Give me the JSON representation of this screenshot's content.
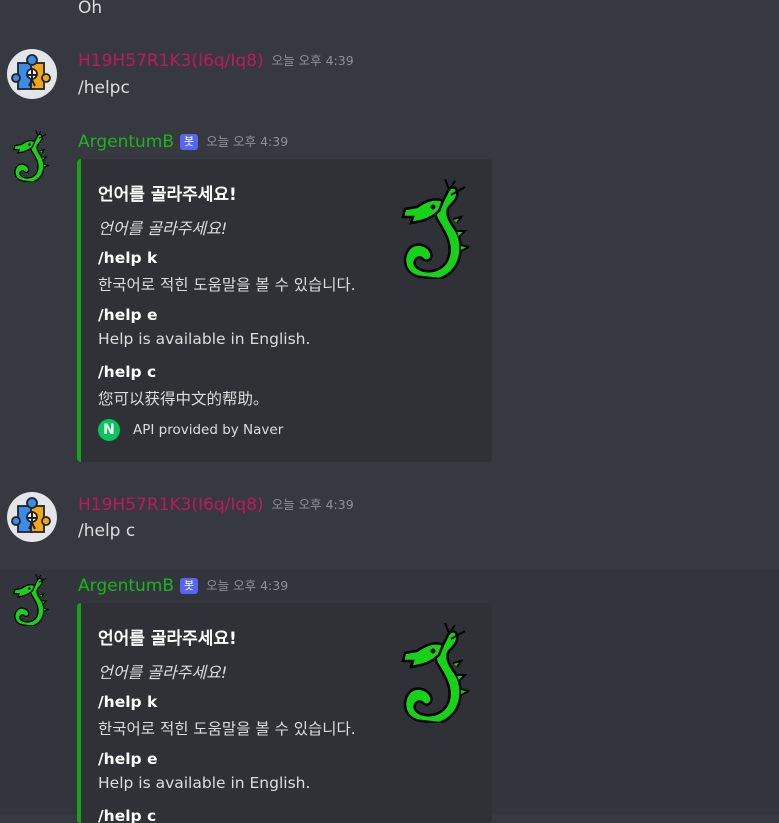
{
  "top_message": {
    "text": "Oh"
  },
  "messages": [
    {
      "author": "H19H57R1K3(I6q/Iq8)",
      "timestamp": "오늘 오후 4:39",
      "text": "/helpc"
    },
    {
      "author": "ArgentumB",
      "badge": "봇",
      "timestamp": "오늘 오후 4:39",
      "embed": {
        "title": "언어를 골라주세요!",
        "description": "언어를 골라주세요!",
        "fields": [
          {
            "name": "/help k",
            "value": "한국어로 적힌 도움말을 볼 수 있습니다."
          },
          {
            "name": "/help e",
            "value": "Help is available in English."
          },
          {
            "name": "/help c",
            "value": "您可以获得中文的帮助。"
          }
        ],
        "footer": "API provided by Naver",
        "footer_icon": "N"
      }
    },
    {
      "author": "H19H57R1K3(I6q/Iq8)",
      "timestamp": "오늘 오후 4:39",
      "text": "/help c"
    },
    {
      "author": "ArgentumB",
      "badge": "봇",
      "timestamp": "오늘 오후 4:39",
      "embed": {
        "title": "언어를 골라주세요!",
        "description": "언어를 골라주세요!",
        "fields": [
          {
            "name": "/help k",
            "value": "한국어로 적힌 도움말을 볼 수 있습니다."
          },
          {
            "name": "/help e",
            "value": "Help is available in English."
          },
          {
            "name": "/help c",
            "value": ""
          }
        ]
      }
    }
  ],
  "colors": {
    "background": "#36393f",
    "embed_background": "#2f3136",
    "embed_accent": "#1aa31a",
    "user_name": "#c2185b",
    "bot_name": "#1db31d",
    "bot_badge": "#5865f2"
  },
  "icons": {
    "user_avatar": "puzzle-piece-icon",
    "bot_avatar": "green-dragon-icon",
    "footer_icon": "naver-logo-icon"
  }
}
